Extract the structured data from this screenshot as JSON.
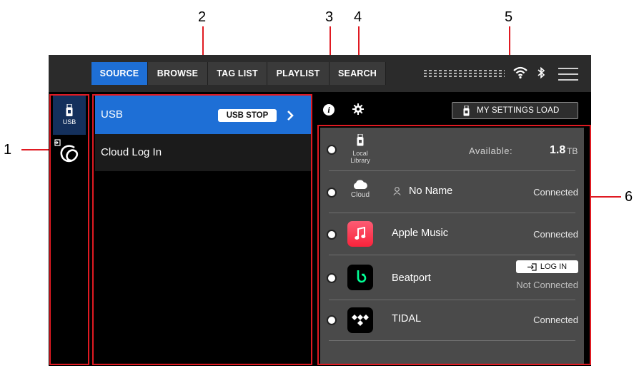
{
  "callouts": [
    "1",
    "2",
    "3",
    "4",
    "5",
    "6"
  ],
  "colors": {
    "accent": "#1e6fd6",
    "highlight": "#e01a22",
    "panel": "#4a4a4a"
  },
  "tabs": [
    {
      "label": "SOURCE",
      "active": true
    },
    {
      "label": "BROWSE",
      "active": false
    },
    {
      "label": "TAG LIST",
      "active": false
    },
    {
      "label": "PLAYLIST",
      "active": false
    },
    {
      "label": "SEARCH",
      "active": false
    }
  ],
  "status_icons": [
    "level-meter-icon",
    "wifi-icon",
    "bluetooth-icon",
    "menu-icon"
  ],
  "strip": {
    "usb_label": "USB",
    "icons": [
      "usb-icon",
      "cloud-login-icon"
    ]
  },
  "list": {
    "rows": [
      {
        "label": "USB",
        "button": "USB STOP",
        "selected": true
      },
      {
        "label": "Cloud Log In",
        "selected": false
      }
    ]
  },
  "toolbar": {
    "icons": [
      "info-icon",
      "gear-icon"
    ],
    "my_settings_label": "MY SETTINGS LOAD"
  },
  "sources": [
    {
      "icon_label": "Local Library",
      "available_label": "Available:",
      "available_value": "1.8",
      "available_unit": "TB"
    },
    {
      "icon_label": "Cloud",
      "name": "No Name",
      "status": "Connected"
    },
    {
      "name": "Apple Music",
      "status": "Connected"
    },
    {
      "name": "Beatport",
      "login_label": "LOG IN",
      "status": "Not Connected"
    },
    {
      "name": "TIDAL",
      "status": "Connected"
    }
  ]
}
